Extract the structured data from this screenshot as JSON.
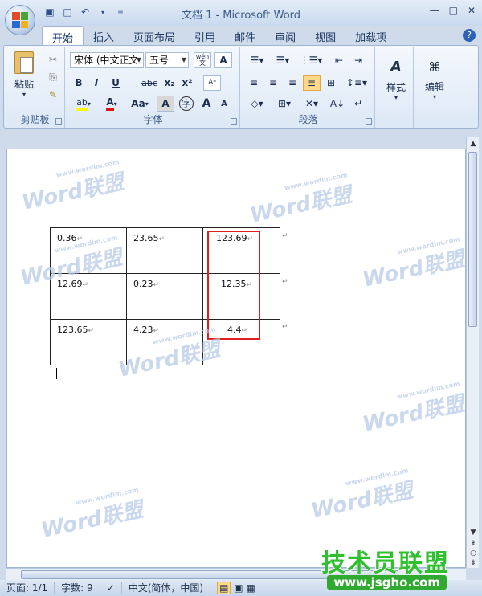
{
  "window": {
    "title": "文档 1 - Microsoft Word",
    "controls": [
      "—",
      "□",
      "✕"
    ]
  },
  "quick_access": [
    "save",
    "new",
    "undo",
    "customize"
  ],
  "tabs": [
    {
      "label": "开始",
      "active": true
    },
    {
      "label": "插入"
    },
    {
      "label": "页面布局"
    },
    {
      "label": "引用"
    },
    {
      "label": "邮件"
    },
    {
      "label": "审阅"
    },
    {
      "label": "视图"
    },
    {
      "label": "加载项"
    }
  ],
  "ribbon": {
    "clipboard": {
      "label": "剪贴板",
      "paste_label": "粘贴"
    },
    "font": {
      "label": "字体",
      "font_name": "宋体 (中文正文)",
      "font_size": "五号",
      "bold": "B",
      "italic": "I",
      "underline": "U",
      "strike": "abc",
      "subscript": "x₂",
      "superscript": "x²",
      "case": "Aa",
      "grow": "A",
      "shrink": "A",
      "char_border": "A",
      "enclose": "字",
      "phonetic": "A",
      "wen": "wén"
    },
    "paragraph": {
      "label": "段落"
    },
    "styles": {
      "label": "样式"
    },
    "editing": {
      "label": "编辑"
    }
  },
  "table": {
    "rows": [
      [
        "0.36",
        "23.65",
        "123.69"
      ],
      [
        "12.69",
        "0.23",
        "12.35"
      ],
      [
        "123.65",
        "4.23",
        "4.4"
      ]
    ]
  },
  "status": {
    "page": "页面: 1/1",
    "words": "字数: 9",
    "language": "中文(简体，中国)"
  },
  "watermark": {
    "text": "Word联盟",
    "url": "www.wordlm.com"
  },
  "brand": {
    "name": "技术员联盟",
    "url": "www.jsgho.com"
  },
  "colors": {
    "accent": "#2e62b5",
    "highlight_box": "#e02020",
    "brand_green": "#2fbf2f"
  }
}
